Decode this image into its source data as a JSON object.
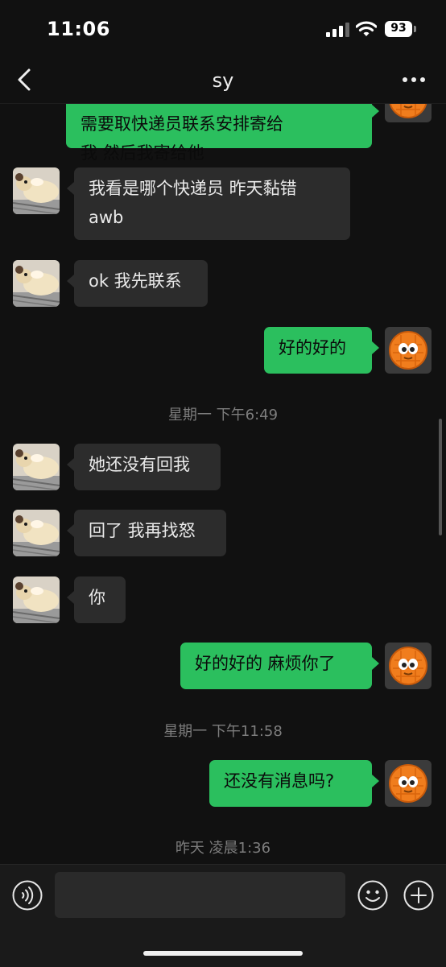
{
  "status_bar": {
    "time": "11:06",
    "battery": "93"
  },
  "header": {
    "title": "sy",
    "back_icon": "chevron-left-icon",
    "more_icon": "ellipsis-icon"
  },
  "messages": [
    {
      "side": "out",
      "text": "需要取快递员联系安排寄给\n我 然后我寄给他"
    },
    {
      "side": "in",
      "text": "我看是哪个快递员 昨天黏错\nawb"
    },
    {
      "side": "in",
      "text": "ok 我先联系"
    },
    {
      "side": "out",
      "text": "好的好的"
    },
    {
      "type": "time",
      "text": "星期一 下午6:49"
    },
    {
      "side": "in",
      "text": "她还没有回我"
    },
    {
      "side": "in",
      "text": "回了 我再找怒"
    },
    {
      "side": "in",
      "text": "你"
    },
    {
      "side": "out",
      "text": "好的好的 麻烦你了"
    },
    {
      "type": "time",
      "text": "星期一 下午11:58"
    },
    {
      "side": "out",
      "text": "还没有消息吗?"
    },
    {
      "type": "time",
      "text": "昨天 凌晨1:36"
    }
  ],
  "input_bar": {
    "voice_icon": "voice-icon",
    "input_value": "",
    "emoji_icon": "emoji-icon",
    "plus_icon": "plus-icon"
  },
  "colors": {
    "background": "#111111",
    "incoming_bubble": "#2c2c2c",
    "outgoing_bubble": "#2bbf5e",
    "timestamp": "#7d7d7d"
  }
}
